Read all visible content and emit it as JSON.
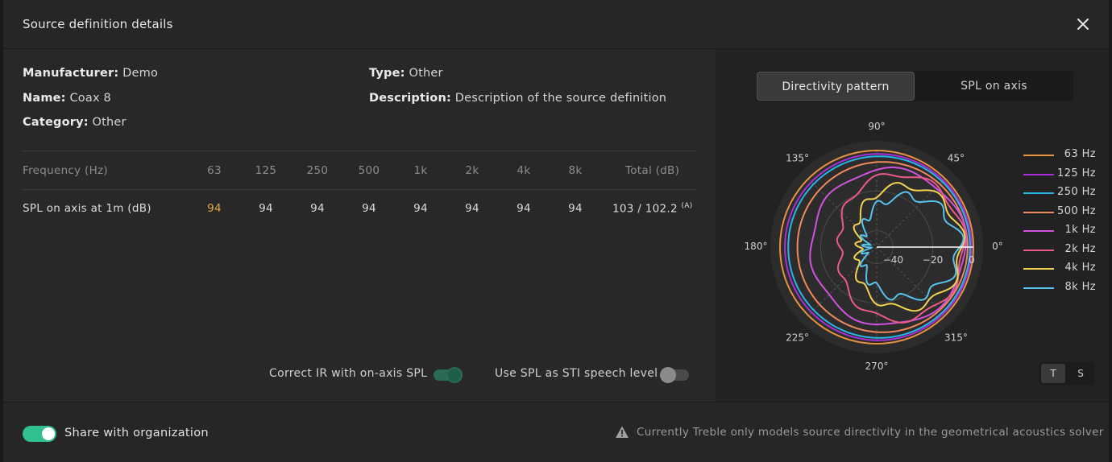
{
  "dialog": {
    "title": "Source definition details"
  },
  "details": {
    "manufacturer_label": "Manufacturer:",
    "manufacturer": "Demo",
    "name_label": "Name:",
    "name": "Coax 8",
    "category_label": "Category:",
    "category": "Other",
    "type_label": "Type:",
    "type": "Other",
    "description_label": "Description:",
    "description": "Description of the source definition"
  },
  "table": {
    "header_label": "Frequency (Hz)",
    "bands": [
      "63",
      "125",
      "250",
      "500",
      "1k",
      "2k",
      "4k",
      "8k"
    ],
    "total_header": "Total (dB)",
    "row_label": "SPL on axis at 1m (dB)",
    "values": [
      "94",
      "94",
      "94",
      "94",
      "94",
      "94",
      "94",
      "94"
    ],
    "total": "103 / 102.2",
    "total_sup": "(A)"
  },
  "toggles": {
    "correct_ir_label": "Correct IR with on-axis SPL",
    "correct_ir_on": true,
    "sti_label": "Use SPL as STI speech level",
    "sti_on": false
  },
  "tabs": {
    "directivity": "Directivity pattern",
    "spl_axis": "SPL on axis",
    "active": "directivity"
  },
  "polar": {
    "angles": [
      "90°",
      "45°",
      "0°",
      "315°",
      "270°",
      "225°",
      "180°",
      "135°"
    ],
    "radial_labels": [
      "−40",
      "−20",
      "0"
    ]
  },
  "legend": [
    {
      "label": "63 Hz",
      "color": "#e8933f"
    },
    {
      "label": "125 Hz",
      "color": "#a92ed8"
    },
    {
      "label": "250 Hz",
      "color": "#26b6e8"
    },
    {
      "label": "500 Hz",
      "color": "#f08a5c"
    },
    {
      "label": "1k Hz",
      "color": "#d252e0"
    },
    {
      "label": "2k Hz",
      "color": "#ec5b86"
    },
    {
      "label": "4k Hz",
      "color": "#f3d250"
    },
    {
      "label": "8k Hz",
      "color": "#56c3ee"
    }
  ],
  "view_toggle": {
    "t": "T",
    "s": "S"
  },
  "footer": {
    "share_label": "Share with organization",
    "share_on": true,
    "warning": "Currently Treble only models source directivity in the geometrical acoustics solver"
  },
  "colors": {
    "accent": "#2fbf90",
    "highlight": "#e0a93b"
  }
}
